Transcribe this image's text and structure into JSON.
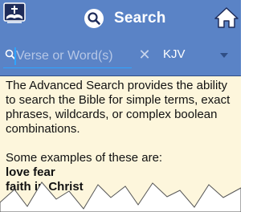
{
  "header": {
    "title": "Search",
    "logo_icon": "bible-app-logo-icon",
    "title_icon": "search-magnifier-icon",
    "home_icon": "home-icon",
    "background_color": "#5a83c6"
  },
  "search": {
    "placeholder": "Verse or Word(s)",
    "value": "",
    "clear_symbol": "✕",
    "version": "KJV",
    "accent_color": "#2ea4ff"
  },
  "content": {
    "description": "The Advanced Search provides the ability to search the Bible for simple terms, exact phrases, wildcards, or complex boolean combinations.",
    "examples_intro": "Some examples of these are:",
    "examples": [
      "love fear",
      "faith in Christ"
    ],
    "background_color": "#fdf6dc"
  }
}
